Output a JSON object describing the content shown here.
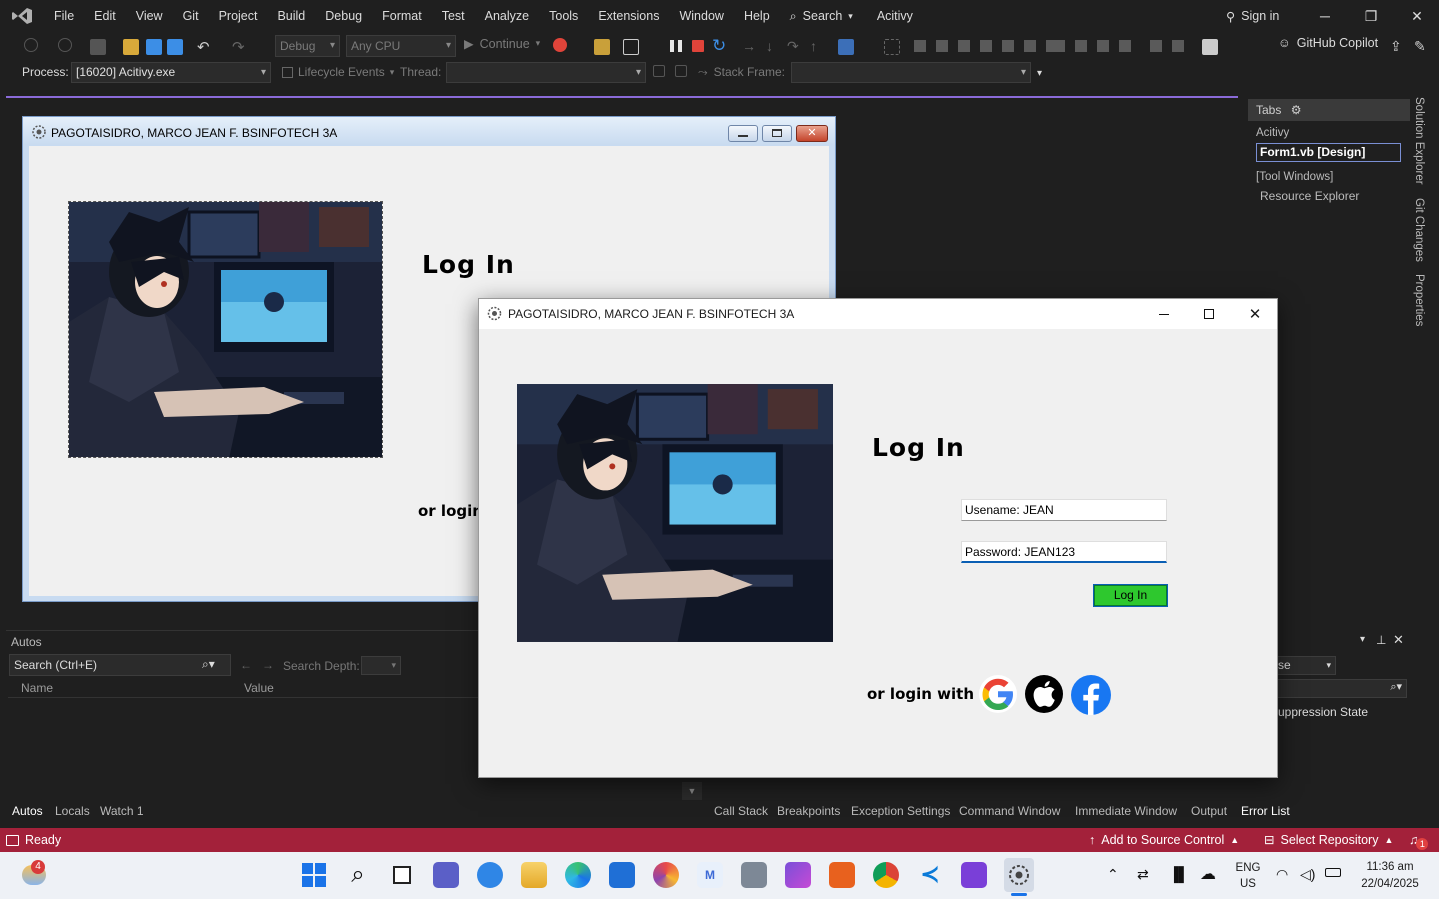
{
  "vs": {
    "menu": [
      "File",
      "Edit",
      "View",
      "Git",
      "Project",
      "Build",
      "Debug",
      "Format",
      "Test",
      "Analyze",
      "Tools",
      "Extensions",
      "Window",
      "Help"
    ],
    "search_label": "Search",
    "project_name": "Acitivy",
    "sign_in": "Sign in",
    "toolbar": {
      "config": "Debug",
      "platform": "Any CPU",
      "continue": "Continue",
      "copilot": "GitHub Copilot"
    },
    "debug_bar": {
      "process_label": "Process:",
      "process_value": "[16020] Acitivy.exe",
      "lifecycle": "Lifecycle Events",
      "thread_label": "Thread:",
      "stack_frame_label": "Stack Frame:"
    },
    "right_panel": {
      "tabs_header": "Tabs",
      "group1": "Acitivy",
      "active_tab": "Form1.vb [Design]",
      "group2": "[Tool Windows]",
      "item": "Resource Explorer",
      "vertical_tabs": [
        "Solution Explorer",
        "Git Changes",
        "Properties"
      ]
    },
    "autos": {
      "title": "Autos",
      "search_placeholder": "Search (Ctrl+E)",
      "search_depth": "Search Depth:",
      "col_name": "Name",
      "col_value": "Value",
      "tabs": [
        "Autos",
        "Locals",
        "Watch 1"
      ]
    },
    "right_bottom": {
      "combo_value": "se",
      "column": "uppression State",
      "tabs": [
        "Call Stack",
        "Breakpoints",
        "Exception Settings",
        "Command Window",
        "Immediate Window",
        "Output",
        "Error List"
      ]
    },
    "status": {
      "ready": "Ready",
      "source_control": "Add to Source Control",
      "repository": "Select Repository",
      "notifications": "1"
    }
  },
  "design_form": {
    "title": "PAGOTAISIDRO, MARCO JEAN F. BSINFOTECH 3A",
    "heading": "Log In",
    "or_login": "or login"
  },
  "login_form": {
    "title": "PAGOTAISIDRO, MARCO JEAN F. BSINFOTECH 3A",
    "heading": "Log In",
    "username": "Usename: JEAN",
    "password": "Password: JEAN123",
    "login_button": "Log In",
    "or_login_with": "or login with",
    "social": [
      "google-icon",
      "apple-icon",
      "facebook-icon"
    ]
  },
  "taskbar": {
    "weather_badge": "4",
    "lang_top": "ENG",
    "lang_bottom": "US",
    "time": "11:36 am",
    "date": "22/04/2025"
  },
  "colors": {
    "accent_purple": "#8a6ad8",
    "statusbar": "#a3213a",
    "login_button": "#2ec82e"
  }
}
